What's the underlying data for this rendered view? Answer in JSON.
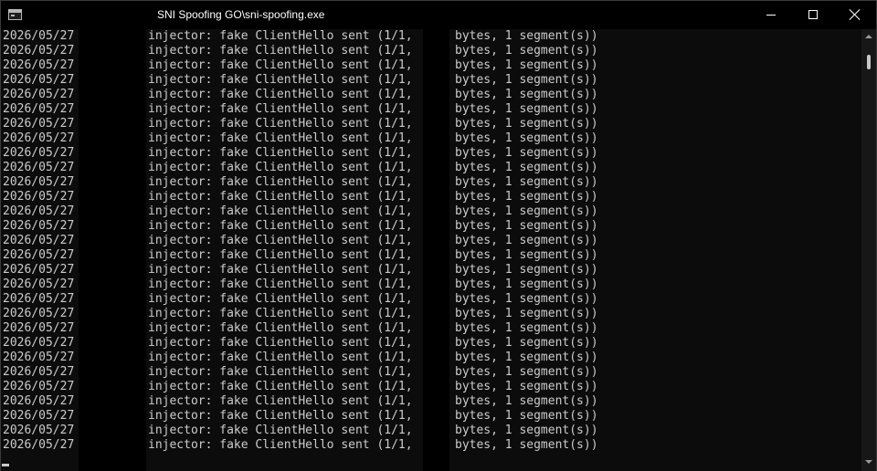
{
  "window": {
    "title": "SNI Spoofing GO\\sni-spoofing.exe",
    "icon": "console-app-icon",
    "controls": {
      "minimize": "minimize-icon",
      "maximize": "maximize-icon",
      "close": "close-icon"
    }
  },
  "console": {
    "colors": {
      "background": "#0c0c0c",
      "text": "#cccccc"
    },
    "lines": [
      {
        "date": "2026/05/27",
        "message": "injector: fake ClientHello sent (1/1,",
        "tail": "bytes, 1 segment(s))"
      },
      {
        "date": "2026/05/27",
        "message": "injector: fake ClientHello sent (1/1,",
        "tail": "bytes, 1 segment(s))"
      },
      {
        "date": "2026/05/27",
        "message": "injector: fake ClientHello sent (1/1,",
        "tail": "bytes, 1 segment(s))"
      },
      {
        "date": "2026/05/27",
        "message": "injector: fake ClientHello sent (1/1,",
        "tail": "bytes, 1 segment(s))"
      },
      {
        "date": "2026/05/27",
        "message": "injector: fake ClientHello sent (1/1,",
        "tail": "bytes, 1 segment(s))"
      },
      {
        "date": "2026/05/27",
        "message": "injector: fake ClientHello sent (1/1,",
        "tail": "bytes, 1 segment(s))"
      },
      {
        "date": "2026/05/27",
        "message": "injector: fake ClientHello sent (1/1,",
        "tail": "bytes, 1 segment(s))"
      },
      {
        "date": "2026/05/27",
        "message": "injector: fake ClientHello sent (1/1,",
        "tail": "bytes, 1 segment(s))"
      },
      {
        "date": "2026/05/27",
        "message": "injector: fake ClientHello sent (1/1,",
        "tail": "bytes, 1 segment(s))"
      },
      {
        "date": "2026/05/27",
        "message": "injector: fake ClientHello sent (1/1,",
        "tail": "bytes, 1 segment(s))"
      },
      {
        "date": "2026/05/27",
        "message": "injector: fake ClientHello sent (1/1,",
        "tail": "bytes, 1 segment(s))"
      },
      {
        "date": "2026/05/27",
        "message": "injector: fake ClientHello sent (1/1,",
        "tail": "bytes, 1 segment(s))"
      },
      {
        "date": "2026/05/27",
        "message": "injector: fake ClientHello sent (1/1,",
        "tail": "bytes, 1 segment(s))"
      },
      {
        "date": "2026/05/27",
        "message": "injector: fake ClientHello sent (1/1,",
        "tail": "bytes, 1 segment(s))"
      },
      {
        "date": "2026/05/27",
        "message": "injector: fake ClientHello sent (1/1,",
        "tail": "bytes, 1 segment(s))"
      },
      {
        "date": "2026/05/27",
        "message": "injector: fake ClientHello sent (1/1,",
        "tail": "bytes, 1 segment(s))"
      },
      {
        "date": "2026/05/27",
        "message": "injector: fake ClientHello sent (1/1,",
        "tail": "bytes, 1 segment(s))"
      },
      {
        "date": "2026/05/27",
        "message": "injector: fake ClientHello sent (1/1,",
        "tail": "bytes, 1 segment(s))"
      },
      {
        "date": "2026/05/27",
        "message": "injector: fake ClientHello sent (1/1,",
        "tail": "bytes, 1 segment(s))"
      },
      {
        "date": "2026/05/27",
        "message": "injector: fake ClientHello sent (1/1,",
        "tail": "bytes, 1 segment(s))"
      },
      {
        "date": "2026/05/27",
        "message": "injector: fake ClientHello sent (1/1,",
        "tail": "bytes, 1 segment(s))"
      },
      {
        "date": "2026/05/27",
        "message": "injector: fake ClientHello sent (1/1,",
        "tail": "bytes, 1 segment(s))"
      },
      {
        "date": "2026/05/27",
        "message": "injector: fake ClientHello sent (1/1,",
        "tail": "bytes, 1 segment(s))"
      },
      {
        "date": "2026/05/27",
        "message": "injector: fake ClientHello sent (1/1,",
        "tail": "bytes, 1 segment(s))"
      },
      {
        "date": "2026/05/27",
        "message": "injector: fake ClientHello sent (1/1,",
        "tail": "bytes, 1 segment(s))"
      },
      {
        "date": "2026/05/27",
        "message": "injector: fake ClientHello sent (1/1,",
        "tail": "bytes, 1 segment(s))"
      },
      {
        "date": "2026/05/27",
        "message": "injector: fake ClientHello sent (1/1,",
        "tail": "bytes, 1 segment(s))"
      },
      {
        "date": "2026/05/27",
        "message": "injector: fake ClientHello sent (1/1,",
        "tail": "bytes, 1 segment(s))"
      },
      {
        "date": "2026/05/27",
        "message": "injector: fake ClientHello sent (1/1,",
        "tail": "bytes, 1 segment(s))"
      }
    ]
  }
}
